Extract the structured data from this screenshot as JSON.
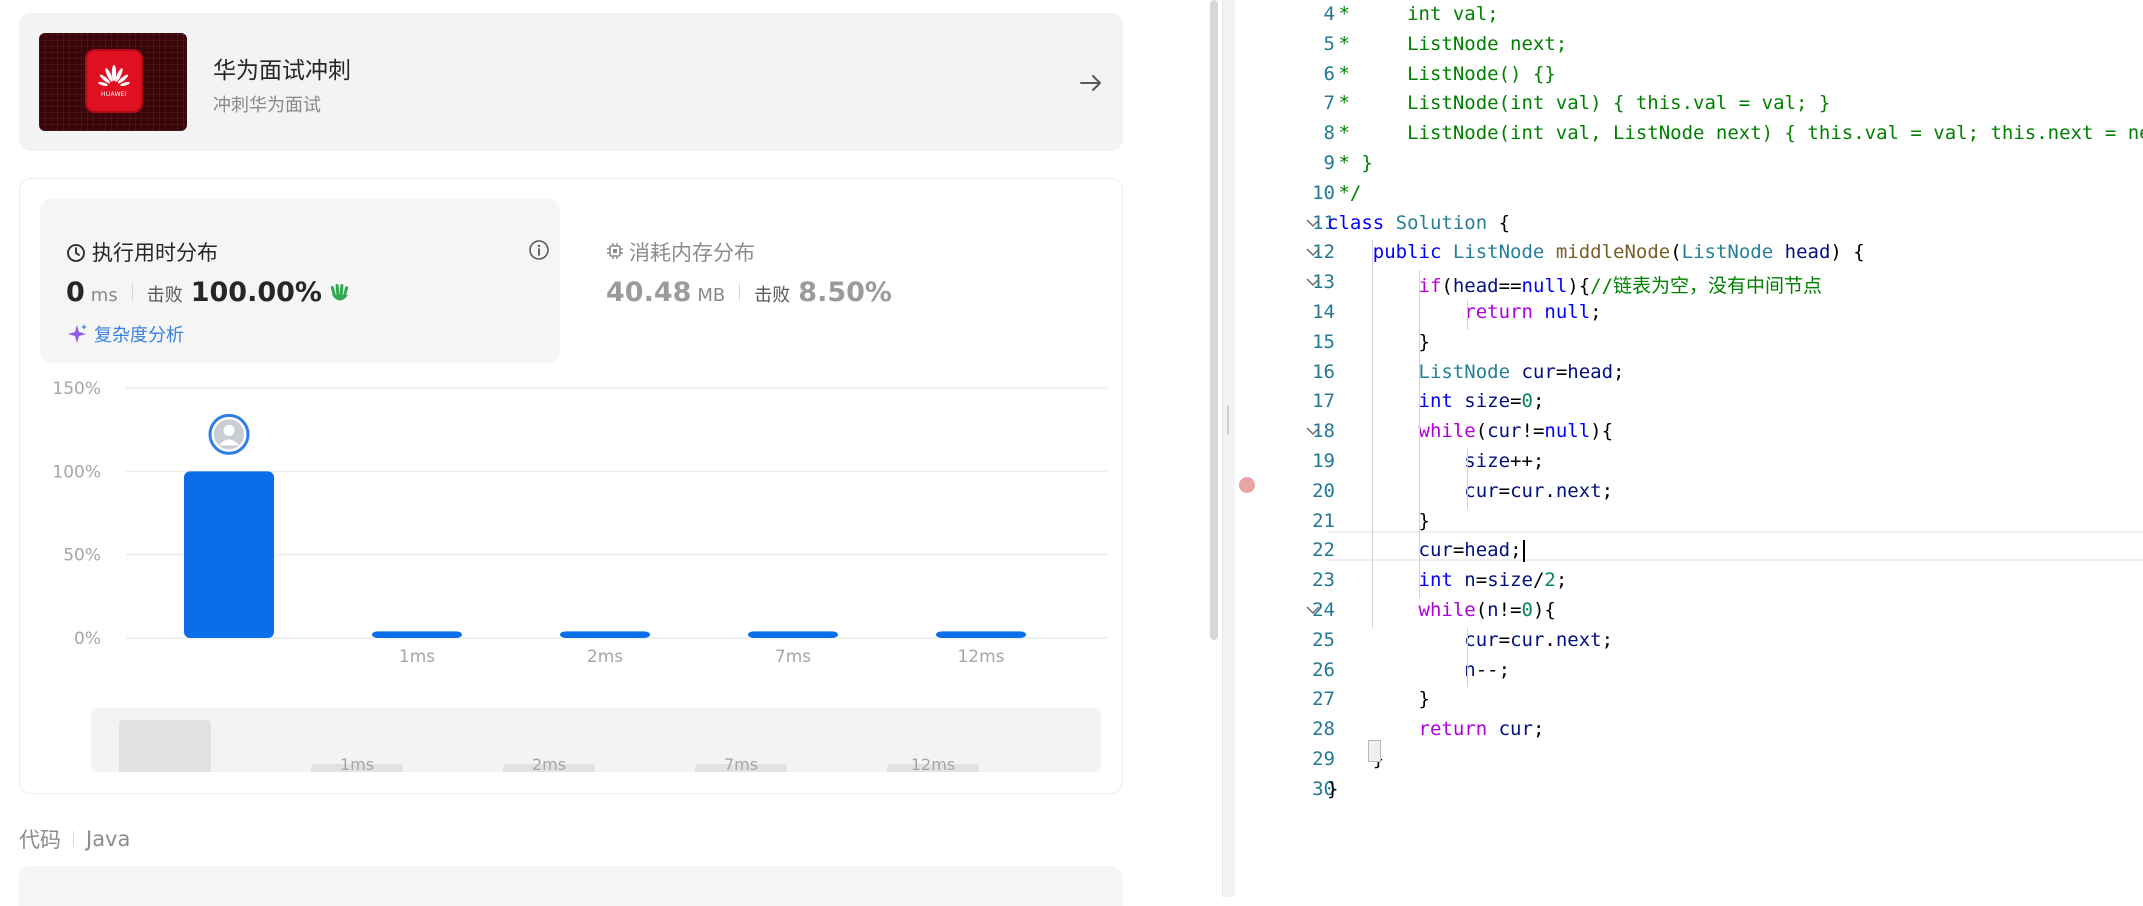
{
  "promo": {
    "title": "华为面试冲刺",
    "subtitle": "冲刺华为面试",
    "logo_word": "HUAWEI",
    "brand_color": "#e01022"
  },
  "runtime": {
    "title": "执行用时分布",
    "value": "0",
    "unit": "ms",
    "beat_label": "击败",
    "beat_value": "100.00%",
    "complexity_label": "复杂度分析"
  },
  "memory": {
    "title": "消耗内存分布",
    "value": "40.48",
    "unit": "MB",
    "beat_label": "击败",
    "beat_value": "8.50%"
  },
  "chart_data": {
    "type": "bar",
    "y_ticks": [
      "150%",
      "100%",
      "50%",
      "0%"
    ],
    "ylim": [
      0,
      150
    ],
    "categories": [
      "",
      "1ms",
      "2ms",
      "7ms",
      "12ms"
    ],
    "values": [
      100,
      4,
      4,
      4,
      4
    ],
    "highlight_index": 0,
    "bar_color": "#0a6ee8",
    "grid": true
  },
  "mini_chart": {
    "categories": [
      "",
      "1ms",
      "2ms",
      "7ms",
      "12ms"
    ]
  },
  "code_section": {
    "label": "代码",
    "language": "Java"
  },
  "editor": {
    "lines": [
      {
        "n": "4",
        "tokens": [
          [
            "cm",
            " *     int val;"
          ]
        ]
      },
      {
        "n": "5",
        "tokens": [
          [
            "cm",
            " *     ListNode next;"
          ]
        ]
      },
      {
        "n": "6",
        "tokens": [
          [
            "cm",
            " *     ListNode() {}"
          ]
        ]
      },
      {
        "n": "7",
        "tokens": [
          [
            "cm",
            " *     ListNode(int val) { this.val = val; }"
          ]
        ]
      },
      {
        "n": "8",
        "tokens": [
          [
            "cm",
            " *     ListNode(int val, ListNode next) { this.val = val; this.next = next; }"
          ]
        ]
      },
      {
        "n": "9",
        "tokens": [
          [
            "cm",
            " * }"
          ]
        ]
      },
      {
        "n": "10",
        "tokens": [
          [
            "cm",
            " */"
          ]
        ]
      },
      {
        "n": "11",
        "fold": true,
        "tokens": [
          [
            "kw",
            "class"
          ],
          [
            "pl",
            " "
          ],
          [
            "ty",
            "Solution"
          ],
          [
            "pl",
            " {"
          ]
        ]
      },
      {
        "n": "12",
        "fold": true,
        "tokens": [
          [
            "pl",
            "    "
          ],
          [
            "kw",
            "public"
          ],
          [
            "pl",
            " "
          ],
          [
            "ty",
            "ListNode"
          ],
          [
            "pl",
            " "
          ],
          [
            "fn",
            "middleNode"
          ],
          [
            "pl",
            "("
          ],
          [
            "ty",
            "ListNode"
          ],
          [
            "pl",
            " "
          ],
          [
            "va",
            "head"
          ],
          [
            "pl",
            ") {"
          ]
        ]
      },
      {
        "n": "13",
        "fold": true,
        "tokens": [
          [
            "pl",
            "        "
          ],
          [
            "ctl",
            "if"
          ],
          [
            "pl",
            "("
          ],
          [
            "va",
            "head"
          ],
          [
            "pl",
            "=="
          ],
          [
            "kw",
            "null"
          ],
          [
            "pl",
            "){"
          ],
          [
            "cm",
            "//链表为空，没有中间节点"
          ]
        ]
      },
      {
        "n": "14",
        "tokens": [
          [
            "pl",
            "            "
          ],
          [
            "ctl",
            "return"
          ],
          [
            "pl",
            " "
          ],
          [
            "kw",
            "null"
          ],
          [
            "pl",
            ";"
          ]
        ]
      },
      {
        "n": "15",
        "tokens": [
          [
            "pl",
            "        }"
          ]
        ]
      },
      {
        "n": "16",
        "tokens": [
          [
            "pl",
            "        "
          ],
          [
            "ty",
            "ListNode"
          ],
          [
            "pl",
            " "
          ],
          [
            "va",
            "cur"
          ],
          [
            "pl",
            "="
          ],
          [
            "va",
            "head"
          ],
          [
            "pl",
            ";"
          ]
        ]
      },
      {
        "n": "17",
        "tokens": [
          [
            "pl",
            "        "
          ],
          [
            "kw",
            "int"
          ],
          [
            "pl",
            " "
          ],
          [
            "va",
            "size"
          ],
          [
            "pl",
            "="
          ],
          [
            "nu",
            "0"
          ],
          [
            "pl",
            ";"
          ]
        ]
      },
      {
        "n": "18",
        "fold": true,
        "tokens": [
          [
            "pl",
            "        "
          ],
          [
            "ctl",
            "while"
          ],
          [
            "pl",
            "("
          ],
          [
            "va",
            "cur"
          ],
          [
            "pl",
            "!="
          ],
          [
            "kw",
            "null"
          ],
          [
            "pl",
            "){"
          ]
        ]
      },
      {
        "n": "19",
        "tokens": [
          [
            "pl",
            "            "
          ],
          [
            "va",
            "size"
          ],
          [
            "pl",
            "++;"
          ]
        ]
      },
      {
        "n": "20",
        "tokens": [
          [
            "pl",
            "            "
          ],
          [
            "va",
            "cur"
          ],
          [
            "pl",
            "="
          ],
          [
            "va",
            "cur"
          ],
          [
            "pl",
            "."
          ],
          [
            "va",
            "next"
          ],
          [
            "pl",
            ";"
          ]
        ]
      },
      {
        "n": "21",
        "tokens": [
          [
            "pl",
            "        }"
          ]
        ]
      },
      {
        "n": "22",
        "tokens": [
          [
            "pl",
            "        "
          ],
          [
            "va",
            "cur"
          ],
          [
            "pl",
            "="
          ],
          [
            "va",
            "head"
          ],
          [
            "pl",
            ";"
          ]
        ]
      },
      {
        "n": "23",
        "tokens": [
          [
            "pl",
            "        "
          ],
          [
            "kw",
            "int"
          ],
          [
            "pl",
            " "
          ],
          [
            "va",
            "n"
          ],
          [
            "pl",
            "="
          ],
          [
            "va",
            "size"
          ],
          [
            "pl",
            "/"
          ],
          [
            "nu",
            "2"
          ],
          [
            "pl",
            ";"
          ]
        ]
      },
      {
        "n": "24",
        "fold": true,
        "tokens": [
          [
            "pl",
            "        "
          ],
          [
            "ctl",
            "while"
          ],
          [
            "pl",
            "("
          ],
          [
            "va",
            "n"
          ],
          [
            "pl",
            "!="
          ],
          [
            "nu",
            "0"
          ],
          [
            "pl",
            "){"
          ]
        ]
      },
      {
        "n": "25",
        "tokens": [
          [
            "pl",
            "            "
          ],
          [
            "va",
            "cur"
          ],
          [
            "pl",
            "="
          ],
          [
            "va",
            "cur"
          ],
          [
            "pl",
            "."
          ],
          [
            "va",
            "next"
          ],
          [
            "pl",
            ";"
          ]
        ]
      },
      {
        "n": "26",
        "tokens": [
          [
            "pl",
            "            "
          ],
          [
            "va",
            "n"
          ],
          [
            "pl",
            "--;"
          ]
        ]
      },
      {
        "n": "27",
        "tokens": [
          [
            "pl",
            "        }"
          ]
        ]
      },
      {
        "n": "28",
        "tokens": [
          [
            "pl",
            "        "
          ],
          [
            "ctl",
            "return"
          ],
          [
            "pl",
            " "
          ],
          [
            "va",
            "cur"
          ],
          [
            "pl",
            ";"
          ]
        ]
      },
      {
        "n": "29",
        "tokens": [
          [
            "pl",
            "    }"
          ]
        ]
      },
      {
        "n": "30",
        "tokens": [
          [
            "pl",
            "}"
          ]
        ]
      }
    ],
    "cursor_line": "22",
    "breakpoint_line": "20"
  }
}
